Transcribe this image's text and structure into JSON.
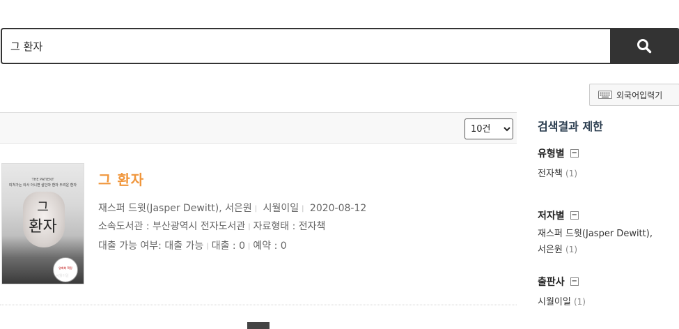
{
  "search": {
    "value": "그 환자",
    "button_icon": "search-icon"
  },
  "foreign_input": {
    "label": "외국어입력기",
    "icon": "keyboard-icon"
  },
  "results": {
    "per_page": "10건",
    "per_page_options": [
      "10건"
    ]
  },
  "item": {
    "title": "그 환자",
    "author": "재스퍼 드윗(Jasper Dewitt), 서은원",
    "publisher": "시월이일",
    "date": "2020-08-12",
    "library": "소속도서관 : 부산광역시 전자도서관",
    "material_type": "자료형태 : 전자책",
    "availability": "대출 가능 여부: 대출 가능",
    "loans": "대출 : 0",
    "reservations": "예약 : 0",
    "cover": {
      "title_line1": "그",
      "title_line2": "환자",
      "eng_title": "THE PATIENT",
      "tagline": "미쳐가는 의사 아니면 살인마 환자 두려운 환자",
      "badge": "영화화 확정",
      "publisher_mark": "시월이일"
    }
  },
  "sidebar": {
    "title": "검색결과 제한",
    "facets": [
      {
        "heading": "유형별",
        "items": [
          {
            "label": "전자책",
            "count": "(1)"
          }
        ]
      },
      {
        "heading": "저자별",
        "items": [
          {
            "label": "재스퍼 드윗(Jasper Dewitt), 서은원",
            "count": "(1)"
          }
        ]
      },
      {
        "heading": "출판사",
        "items": [
          {
            "label": "시월이일",
            "count": "(1)"
          }
        ]
      }
    ],
    "collapse_symbol": "−"
  }
}
